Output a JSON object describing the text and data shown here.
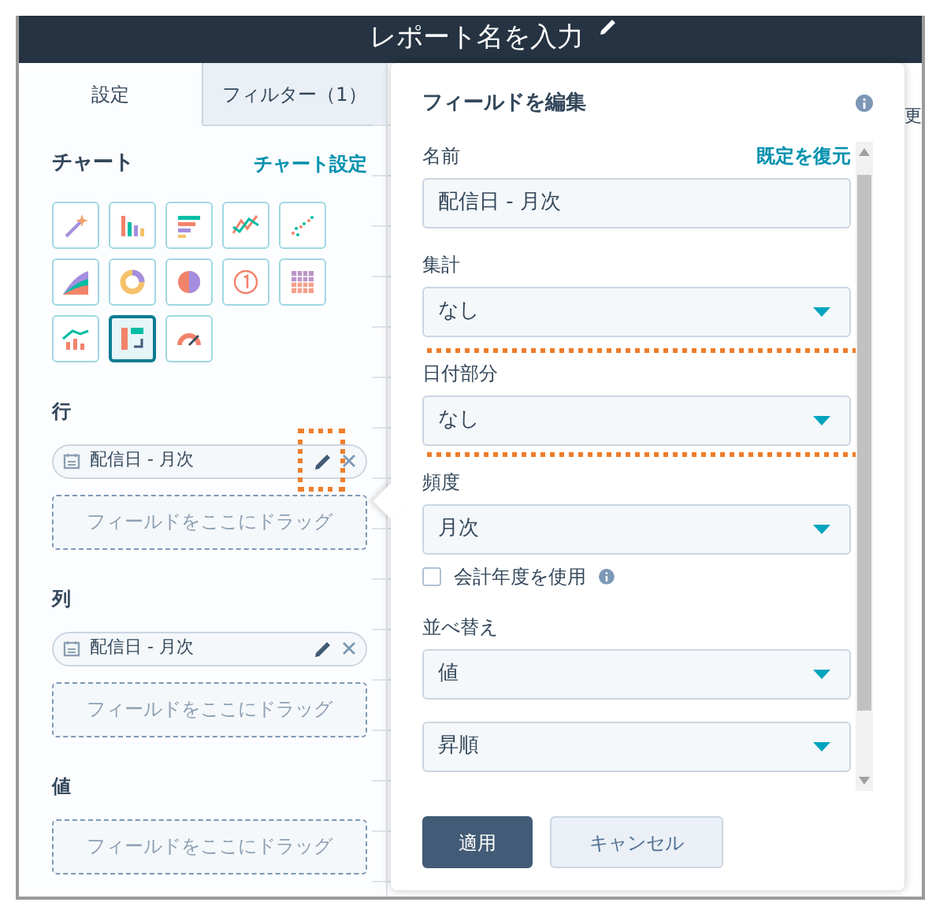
{
  "header": {
    "title": "レポート名を入力"
  },
  "tabs": [
    {
      "label": "設定",
      "selected": true
    },
    {
      "label": "フィルター（1）",
      "selected": false
    }
  ],
  "chart": {
    "heading": "チャート",
    "settings_link": "チャート設定",
    "types": [
      {
        "kind": "magic",
        "selected": false
      },
      {
        "kind": "column",
        "selected": false
      },
      {
        "kind": "bar",
        "selected": false
      },
      {
        "kind": "line",
        "selected": false
      },
      {
        "kind": "scatter",
        "selected": false
      },
      {
        "kind": "area",
        "selected": false
      },
      {
        "kind": "donut",
        "selected": false
      },
      {
        "kind": "pie",
        "selected": false
      },
      {
        "kind": "number",
        "selected": false
      },
      {
        "kind": "heatmap",
        "selected": false
      },
      {
        "kind": "combo",
        "selected": false
      },
      {
        "kind": "pivot",
        "selected": true
      },
      {
        "kind": "gauge",
        "selected": false
      }
    ]
  },
  "sections": [
    {
      "label": "行",
      "pills": [
        {
          "text": "配信日 - 月次",
          "edit_highlighted": true
        }
      ],
      "dropzone": "フィールドをここにドラッグ"
    },
    {
      "label": "列",
      "pills": [
        {
          "text": "配信日 - 月次",
          "edit_highlighted": false
        }
      ],
      "dropzone": "フィールドをここにドラッグ"
    },
    {
      "label": "値",
      "dropzone": "フィールドをここにドラッグ"
    }
  ],
  "background_table": {
    "column_header": "更"
  },
  "popover": {
    "title": "フィールドを編集",
    "fields": [
      {
        "kind": "input",
        "label": "名前",
        "link": "既定を復元",
        "value": "配信日 - 月次",
        "highlighted": false
      },
      {
        "kind": "select",
        "label": "集計",
        "value": "なし",
        "highlighted": false
      },
      {
        "kind": "select",
        "label": "日付部分",
        "value": "なし",
        "highlighted": true
      },
      {
        "kind": "select",
        "label": "頻度",
        "value": "月次",
        "highlighted": false
      },
      {
        "kind": "checkbox",
        "label": "会計年度を使用",
        "checked": false
      },
      {
        "kind": "select",
        "label": "並べ替え",
        "value": "値",
        "highlighted": false
      },
      {
        "kind": "select",
        "value": "昇順",
        "highlighted": false
      }
    ],
    "buttons": [
      {
        "label": "適用",
        "kind": "primary"
      },
      {
        "label": "キャンセル",
        "kind": "secondary"
      }
    ]
  }
}
